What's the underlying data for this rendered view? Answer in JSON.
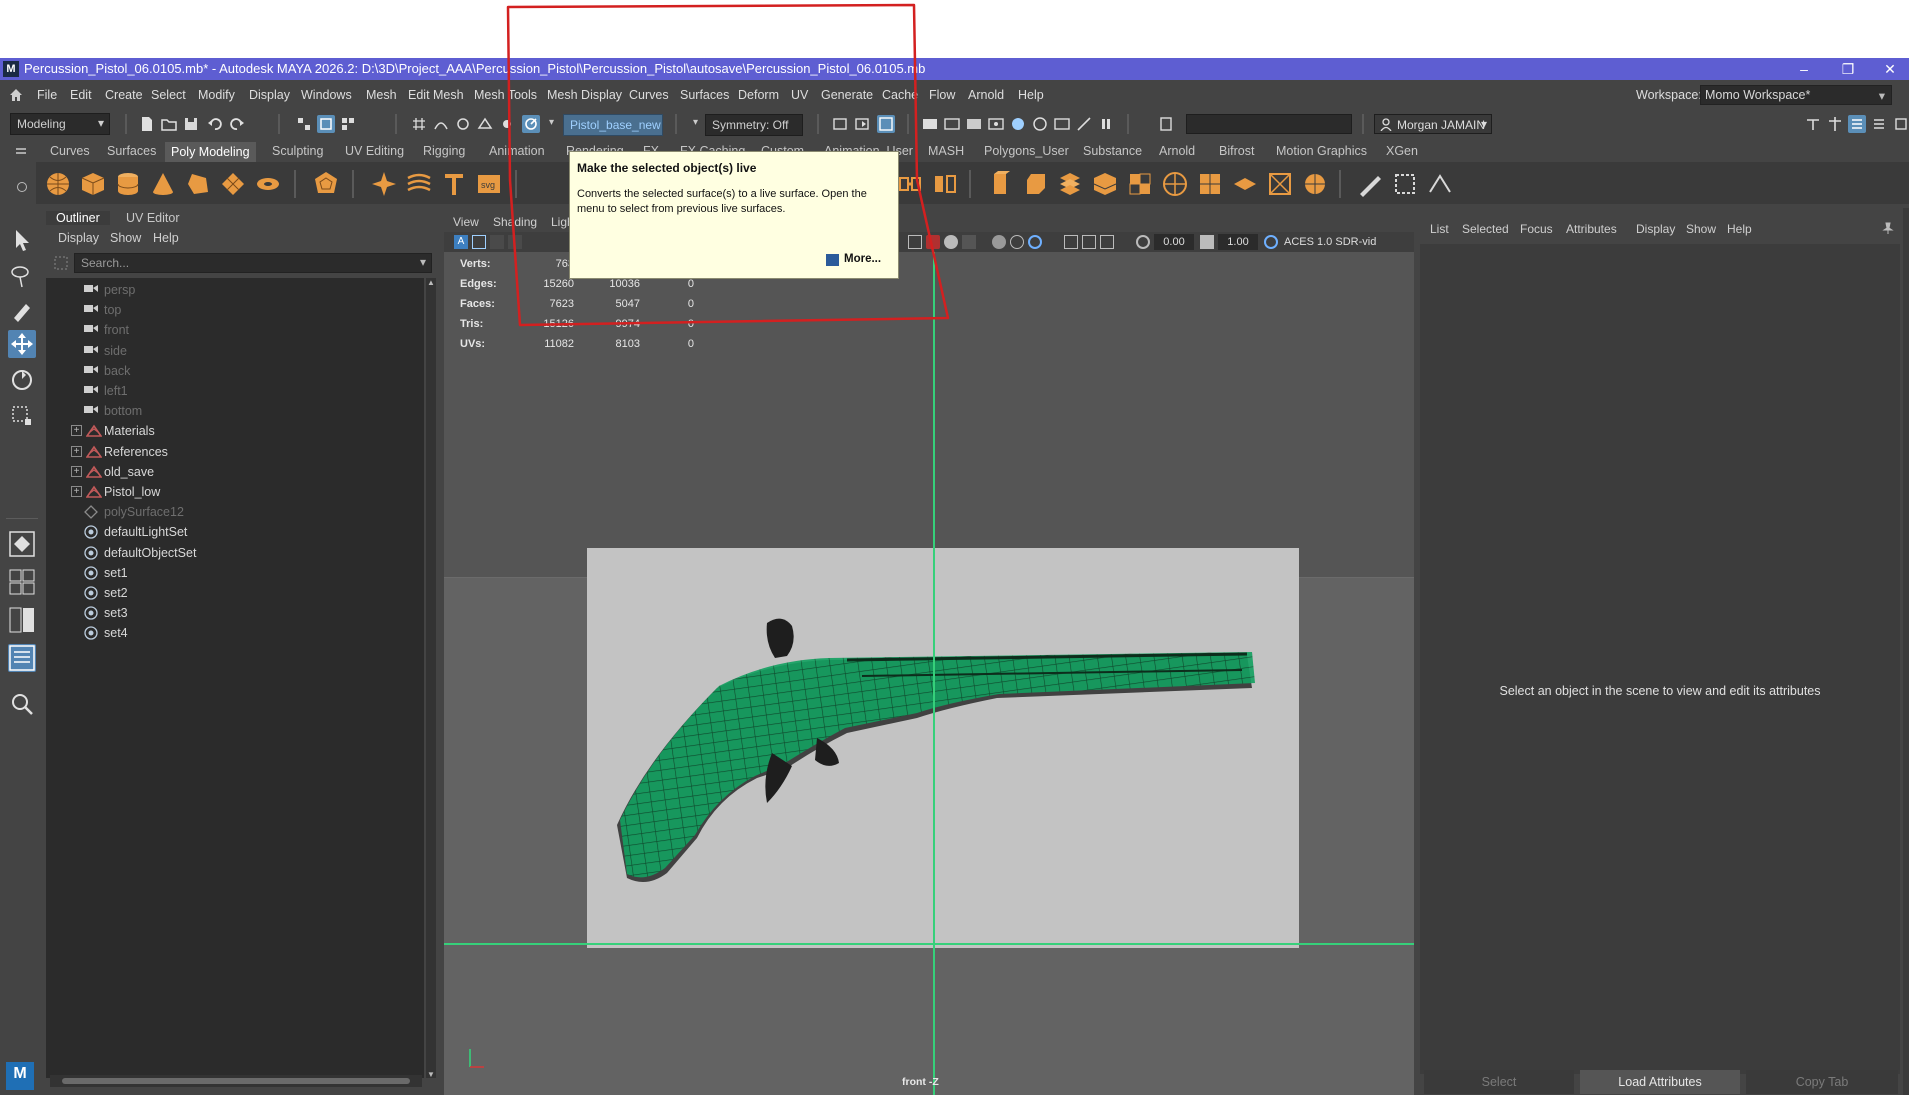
{
  "titlebar": {
    "title": "Percussion_Pistol_06.0105.mb* - Autodesk MAYA 2026.2: D:\\3D\\Project_AAA\\Percussion_Pistol\\Percussion_Pistol\\autosave\\Percussion_Pistol_06.0105.mb",
    "logo_letter": "M",
    "minimize": "–",
    "maximize": "❐",
    "close": "✕"
  },
  "menubar": {
    "items": [
      "File",
      "Edit",
      "Create",
      "Select",
      "Modify",
      "Display",
      "Windows",
      "Mesh",
      "Edit Mesh",
      "Mesh Tools",
      "Mesh Display",
      "Curves",
      "Surfaces",
      "Deform",
      "UV",
      "Generate",
      "Cache",
      "Flow",
      "Arnold",
      "Help"
    ],
    "workspace_label": "Workspace:",
    "workspace_value": "Momo Workspace*"
  },
  "statusline": {
    "menuset": "Modeling",
    "object_name": "Pistol_base_new",
    "symmetry": "Symmetry: Off",
    "user": "Morgan JAMAIN"
  },
  "shelf": {
    "tabs": [
      "Curves",
      "Surfaces",
      "Poly Modeling",
      "Sculpting",
      "UV Editing",
      "Rigging",
      "Animation",
      "Rendering",
      "FX",
      "FX Caching",
      "Custom",
      "Animation_User",
      "MASH",
      "Polygons_User",
      "Substance",
      "Arnold",
      "Bifrost",
      "Motion Graphics",
      "XGen"
    ],
    "active_tab": "Poly Modeling",
    "accent": "#e89a42"
  },
  "outliner": {
    "tabs": [
      "Outliner",
      "UV Editor"
    ],
    "menu": [
      "Display",
      "Show",
      "Help"
    ],
    "search_placeholder": "Search...",
    "rows": [
      {
        "label": "persp",
        "icon": "camera-icon",
        "dim": true
      },
      {
        "label": "top",
        "icon": "camera-icon",
        "dim": true
      },
      {
        "label": "front",
        "icon": "camera-icon",
        "dim": true
      },
      {
        "label": "side",
        "icon": "camera-icon",
        "dim": true
      },
      {
        "label": "back",
        "icon": "camera-icon",
        "dim": true
      },
      {
        "label": "left1",
        "icon": "camera-icon",
        "dim": true
      },
      {
        "label": "bottom",
        "icon": "camera-icon",
        "dim": true
      },
      {
        "label": "Materials",
        "icon": "group-icon",
        "dim": false,
        "expandable": true
      },
      {
        "label": "References",
        "icon": "group-icon",
        "dim": false,
        "expandable": true
      },
      {
        "label": "old_save",
        "icon": "group-icon",
        "dim": false,
        "expandable": true
      },
      {
        "label": "Pistol_low",
        "icon": "group-icon",
        "dim": false,
        "expandable": true
      },
      {
        "label": "polySurface12",
        "icon": "mesh-icon",
        "dim": true
      },
      {
        "label": "defaultLightSet",
        "icon": "set-icon",
        "dim": false
      },
      {
        "label": "defaultObjectSet",
        "icon": "set-icon",
        "dim": false
      },
      {
        "label": "set1",
        "icon": "set-icon",
        "dim": false
      },
      {
        "label": "set2",
        "icon": "set-icon",
        "dim": false
      },
      {
        "label": "set3",
        "icon": "set-icon",
        "dim": false
      },
      {
        "label": "set4",
        "icon": "set-icon",
        "dim": false
      }
    ]
  },
  "viewport": {
    "menu": [
      "View",
      "Shading",
      "Ligh"
    ],
    "exposure": "0.00",
    "gamma": "1.00",
    "color_space": "ACES 1.0 SDR-vid",
    "stats": [
      {
        "label": "Verts:",
        "v1": "763",
        "v2": "",
        "v3": ""
      },
      {
        "label": "Edges:",
        "v1": "15260",
        "v2": "10036",
        "v3": "0"
      },
      {
        "label": "Faces:",
        "v1": "7623",
        "v2": "5047",
        "v3": "0"
      },
      {
        "label": "Tris:",
        "v1": "15126",
        "v2": "9974",
        "v3": "0"
      },
      {
        "label": "UVs:",
        "v1": "11082",
        "v2": "8103",
        "v3": "0"
      }
    ],
    "camera_label": "front -Z",
    "wire_color": "#12a060",
    "grid_color": "#36d07a"
  },
  "tooltip": {
    "title": "Make the selected object(s) live",
    "body": "Converts the selected surface(s) to a live surface. Open the menu to select from previous live surfaces.",
    "more": "More..."
  },
  "attribute_editor": {
    "menu": [
      "List",
      "Selected",
      "Focus",
      "Attributes",
      "Display",
      "Show",
      "Help"
    ],
    "message": "Select an object in the scene to view and edit its attributes",
    "buttons": [
      "Select",
      "Load Attributes",
      "Copy Tab"
    ]
  },
  "annotation": {
    "color": "#d32020"
  }
}
